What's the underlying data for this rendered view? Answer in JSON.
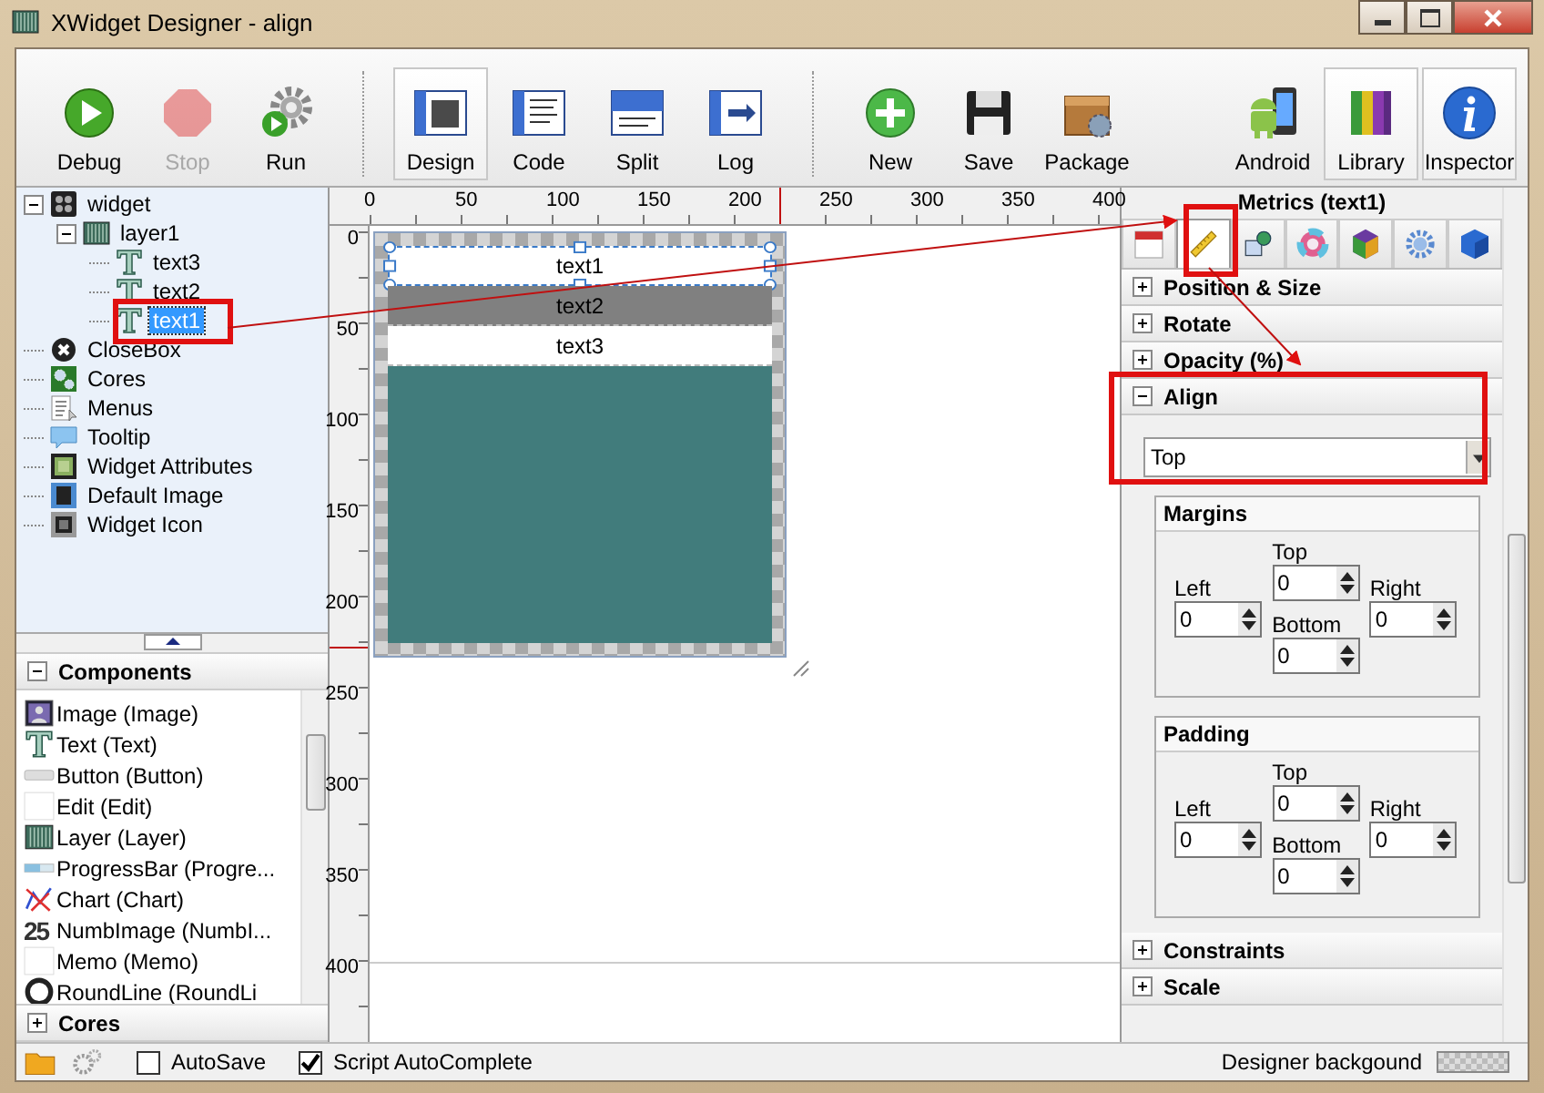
{
  "window": {
    "title": "XWidget Designer - align"
  },
  "toolbar_groups": [
    {
      "buttons": [
        {
          "label": "Debug",
          "selected": false,
          "disabled": false
        },
        {
          "label": "Stop",
          "selected": false,
          "disabled": true
        },
        {
          "label": "Run",
          "selected": false,
          "disabled": false
        }
      ]
    },
    {
      "buttons": [
        {
          "label": "Design",
          "selected": true,
          "disabled": false
        },
        {
          "label": "Code",
          "selected": false,
          "disabled": false
        },
        {
          "label": "Split",
          "selected": false,
          "disabled": false
        },
        {
          "label": "Log",
          "selected": false,
          "disabled": false
        }
      ]
    },
    {
      "buttons": [
        {
          "label": "New",
          "selected": false,
          "disabled": false
        },
        {
          "label": "Save",
          "selected": false,
          "disabled": false
        },
        {
          "label": "Package",
          "selected": false,
          "disabled": false
        }
      ]
    },
    {
      "buttons": [
        {
          "label": "Android",
          "selected": false,
          "disabled": false
        },
        {
          "label": "Library",
          "selected": true,
          "disabled": false
        },
        {
          "label": "Inspector",
          "selected": true,
          "disabled": false
        }
      ]
    }
  ],
  "tree": [
    {
      "label": "widget",
      "selected": false,
      "expanded": true,
      "children": [
        {
          "label": "layer1",
          "selected": false,
          "expanded": true,
          "children": [
            {
              "label": "text3",
              "selected": false
            },
            {
              "label": "text2",
              "selected": false
            },
            {
              "label": "text1",
              "selected": true
            }
          ]
        }
      ]
    },
    {
      "label": "CloseBox",
      "selected": false
    },
    {
      "label": "Cores",
      "selected": false
    },
    {
      "label": "Menus",
      "selected": false
    },
    {
      "label": "Tooltip",
      "selected": false
    },
    {
      "label": "Widget Attributes",
      "selected": false
    },
    {
      "label": "Default Image",
      "selected": false
    },
    {
      "label": "Widget Icon",
      "selected": false
    }
  ],
  "components": {
    "title": "Components",
    "expanded": true,
    "items": [
      {
        "label": "Image (Image)"
      },
      {
        "label": "Text (Text)"
      },
      {
        "label": "Button (Button)"
      },
      {
        "label": "Edit (Edit)"
      },
      {
        "label": "Layer (Layer)"
      },
      {
        "label": "ProgressBar (Progre..."
      },
      {
        "label": "Chart (Chart)"
      },
      {
        "label": "NumbImage (NumbI...",
        "icon_text": "25"
      },
      {
        "label": "Memo (Memo)"
      },
      {
        "label": "RoundLine (RoundLi"
      }
    ]
  },
  "cores": {
    "title": "Cores",
    "expanded": false
  },
  "canvas": {
    "x_ruler": [
      "0",
      "50",
      "100",
      "150",
      "200",
      "250",
      "300",
      "350",
      "400"
    ],
    "y_ruler": [
      "0",
      "50",
      "100",
      "150",
      "200",
      "250",
      "300",
      "350",
      "400"
    ],
    "items": [
      {
        "label": "text1",
        "color": "#ffffff",
        "selected": true
      },
      {
        "label": "text2",
        "color": "#808080",
        "selected": false
      },
      {
        "label": "text3",
        "color": "#ffffff",
        "selected": false
      }
    ]
  },
  "inspector": {
    "title": "Metrics (text1)",
    "tabs": [
      {
        "selected": false
      },
      {
        "selected": true
      },
      {
        "selected": false
      },
      {
        "selected": false
      },
      {
        "selected": false
      },
      {
        "selected": false
      },
      {
        "selected": false
      }
    ],
    "sections": [
      {
        "title": "Position & Size",
        "expanded": false
      },
      {
        "title": "Rotate",
        "expanded": false
      },
      {
        "title": "Opacity (%)",
        "expanded": false
      },
      {
        "title": "Align",
        "expanded": true,
        "select": "Top",
        "groups": [
          {
            "title": "Margins",
            "top": {
              "label": "Top",
              "value": "0"
            },
            "left": {
              "label": "Left",
              "value": "0"
            },
            "right": {
              "label": "Right",
              "value": "0"
            },
            "bottom": {
              "label": "Bottom",
              "value": "0"
            }
          },
          {
            "title": "Padding",
            "top": {
              "label": "Top",
              "value": "0"
            },
            "left": {
              "label": "Left",
              "value": "0"
            },
            "right": {
              "label": "Right",
              "value": "0"
            },
            "bottom": {
              "label": "Bottom",
              "value": "0"
            }
          }
        ]
      },
      {
        "title": "Constraints",
        "expanded": false
      },
      {
        "title": "Scale",
        "expanded": false
      }
    ]
  },
  "status_bar": {
    "autosave": {
      "label": "AutoSave",
      "checked": false
    },
    "autocomplete": {
      "label": "Script AutoComplete",
      "checked": true
    },
    "background_label": "Designer backgound"
  }
}
